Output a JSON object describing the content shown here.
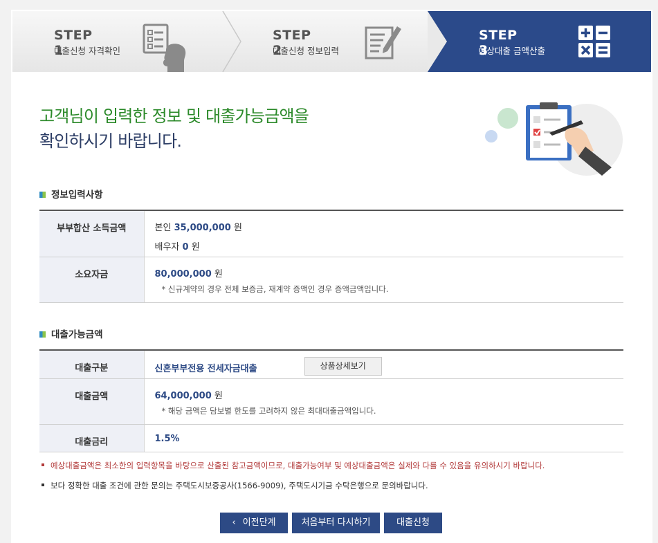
{
  "steps": [
    {
      "num": "STEP 1",
      "label": "대출신청 자격확인",
      "icon": "checklist-person-icon"
    },
    {
      "num": "STEP 2",
      "label": "대출신청 정보입력",
      "icon": "document-pen-icon"
    },
    {
      "num": "STEP 3",
      "label": "예상대출 금액산출",
      "icon": "calculator-icon"
    }
  ],
  "headline": {
    "line1": "고객님이 입력한 정보 및 대출가능금액을",
    "line2": "확인하시기 바랍니다."
  },
  "info_section": {
    "title": "정보입력사항",
    "income_label": "부부합산 소득금액",
    "self_prefix": "본인",
    "self_value": "35,000,000",
    "spouse_prefix": "배우자",
    "spouse_value": "0",
    "unit": "원",
    "need_label": "소요자금",
    "need_value": "80,000,000",
    "need_note": "* 신규계약의 경우 전체 보증금, 재계약 증액인 경우 증액금액입니다."
  },
  "loan_section": {
    "title": "대출가능금액",
    "type_label": "대출구분",
    "type_value": "신혼부부전용 전세자금대출",
    "detail_button": "상품상세보기",
    "amount_label": "대출금액",
    "amount_value": "64,000,000",
    "amount_note": "* 해당 금액은 담보별 한도를 고려하지 않은 최대대출금액입니다.",
    "rate_label": "대출금리",
    "rate_value": "1.5%"
  },
  "notices": [
    "예상대출금액은 최소한의 입력항목을 바탕으로 산출된 참고금액이므로, 대출가능여부 및 예상대출금액은 실제와 다를 수 있음을 유의하시기 바랍니다.",
    "보다 정확한 대출 조건에 관한 문의는 주택도시보증공사(1566-9009), 주택도시기금 수탁은행으로 문의바랍니다."
  ],
  "buttons": {
    "prev": "이전단계",
    "restart": "처음부터 다시하기",
    "apply": "대출신청"
  },
  "colors": {
    "navy": "#2d4a85",
    "step_active": "#2b4a8a",
    "headline_green": "#2c8a2a",
    "notice_red": "#b23a3a"
  }
}
